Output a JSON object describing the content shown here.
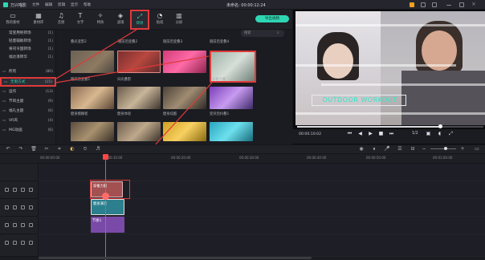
{
  "titlebar": {
    "app_name": "万兴喵影",
    "menus": [
      "文件",
      "编辑",
      "剪辑",
      "显示",
      "帮助"
    ],
    "window_title": "未命名: 00:00:12:24"
  },
  "toolbar": {
    "tools": [
      {
        "label": "我的素材",
        "icon": "folder-icon"
      },
      {
        "label": "素材库",
        "icon": "media-icon"
      },
      {
        "label": "音频",
        "icon": "music-icon"
      },
      {
        "label": "文字",
        "icon": "text-icon"
      },
      {
        "label": "特效",
        "icon": "fx-icon"
      },
      {
        "label": "滤镜",
        "icon": "filter-icon"
      },
      {
        "label": "转场",
        "icon": "transition-icon"
      },
      {
        "label": "贴纸",
        "icon": "sticker-icon"
      },
      {
        "label": "分屏",
        "icon": "split-icon"
      }
    ],
    "export_label": "导出视频"
  },
  "sidebar": {
    "items": [
      {
        "label": "常变用绝转场",
        "count": "(1)"
      },
      {
        "label": "轻量辅助转场",
        "count": "(1)"
      },
      {
        "label": "将司令国转场",
        "count": "(1)"
      },
      {
        "label": "福达凑转华",
        "count": "(1)"
      },
      {
        "label": "所有",
        "count": "(80)"
      },
      {
        "label": "无限方式",
        "count": "(15)"
      },
      {
        "label": "运作",
        "count": "(13)"
      },
      {
        "label": "节目主题",
        "count": "(9)"
      },
      {
        "label": "福礼主题",
        "count": "(6)"
      },
      {
        "label": "VR风",
        "count": "(4)"
      },
      {
        "label": "MG动画",
        "count": "(6)"
      }
    ]
  },
  "grid": {
    "search_placeholder": "搜索",
    "row1_labels": [
      "叠光变影2",
      "随前后变叠2",
      "随前后变叠3",
      "随前后变叠4"
    ],
    "row2_labels": [
      "随前后变叠1",
      "扫光叠影",
      "",
      "穿梭力量"
    ],
    "row3_labels": [
      "健身模糊者",
      "健身体验",
      "健身炫酷",
      "变突后抖叠1"
    ],
    "row4_labels": [
      "",
      "",
      "",
      ""
    ]
  },
  "preview": {
    "overlay_text": "OUTDOOR WORKOUT",
    "timecode": "00:00:10:02",
    "ratio": "1/2",
    "progress": 0.77
  },
  "ruler": {
    "ticks": [
      "00:00:00:00",
      "00:00:10:00",
      "00:00:20:00",
      "00:00:30:00",
      "00:00:40:00",
      "00:00:50:00",
      "00:01:00:00"
    ]
  },
  "timeline": {
    "clips": [
      {
        "label": "穿梭力量"
      },
      {
        "label": "健身演示"
      },
      {
        "label": "节奏1"
      }
    ]
  },
  "colors": {
    "accent": "#2fd6b4",
    "highlight": "#e03a3a",
    "playhead": "#ff4747"
  }
}
